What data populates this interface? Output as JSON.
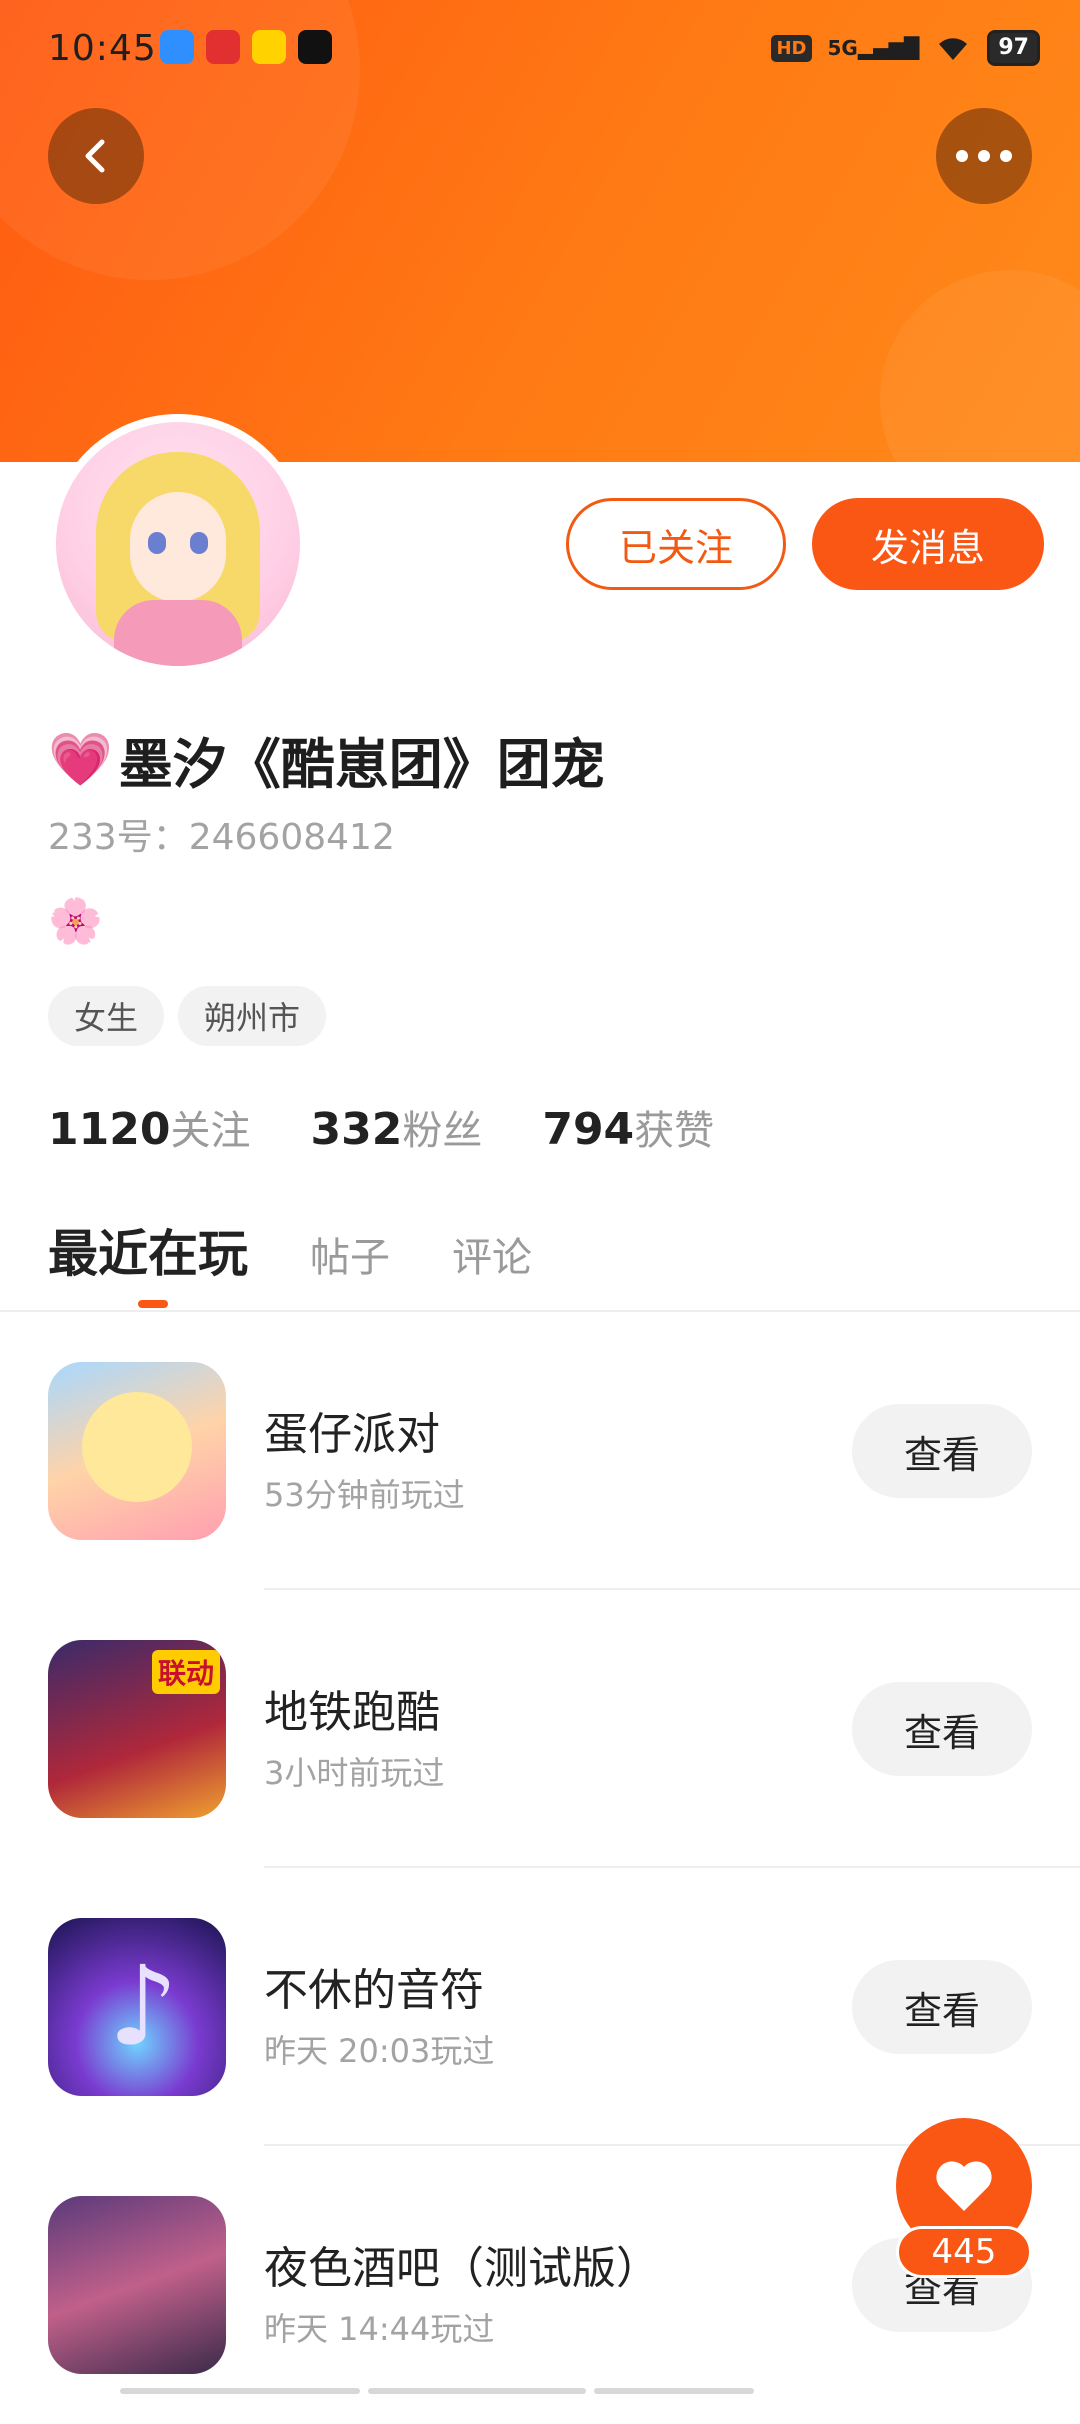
{
  "status_bar": {
    "time": "10:45",
    "hd": "HD",
    "network": "5G",
    "battery": "97"
  },
  "header": {
    "back_icon": "chevron-left-icon",
    "more_icon": "more-dots-icon"
  },
  "profile": {
    "name_emoji": "💗",
    "name": "墨汐《酷崽团》团宠",
    "uid_label": "233号：246608412",
    "signature": "🌸",
    "tags": [
      "女生",
      "朔州市"
    ],
    "follow_button": "已关注",
    "message_button": "发消息",
    "stats": [
      {
        "num": "1120",
        "label": "关注"
      },
      {
        "num": "332",
        "label": "粉丝"
      },
      {
        "num": "794",
        "label": "获赞"
      }
    ]
  },
  "tabs": [
    "最近在玩",
    "帖子",
    "评论"
  ],
  "games": [
    {
      "title": "蛋仔派对",
      "sub": "53分钟前玩过",
      "action": "查看"
    },
    {
      "title": "地铁跑酷",
      "sub": "3小时前玩过",
      "action": "查看",
      "badge": "联动"
    },
    {
      "title": "不休的音符",
      "sub": "昨天 20:03玩过",
      "action": "查看"
    },
    {
      "title": "夜色酒吧（测试版）",
      "sub": "昨天 14:44玩过",
      "action": "查看"
    }
  ],
  "like_fab": {
    "count": "445"
  },
  "colors": {
    "accent": "#fa5714",
    "banner_start": "#ff5a12",
    "banner_end": "#ff8a1a"
  }
}
